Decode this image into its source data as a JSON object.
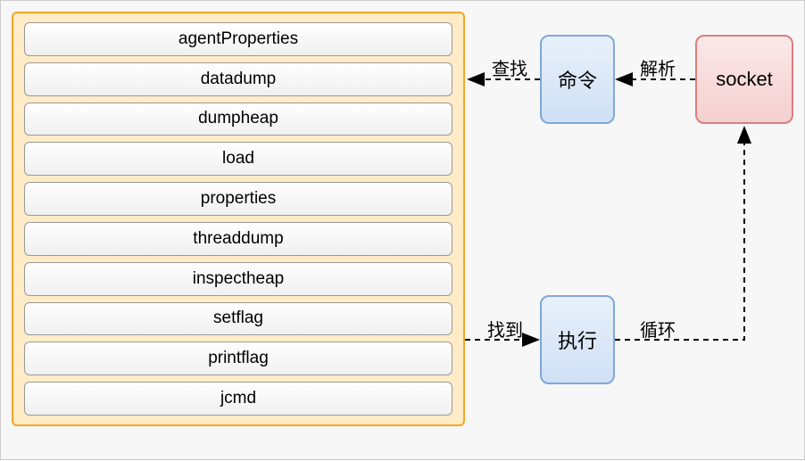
{
  "commands": {
    "items": [
      {
        "label": "agentProperties"
      },
      {
        "label": "datadump"
      },
      {
        "label": "dumpheap"
      },
      {
        "label": "load"
      },
      {
        "label": "properties"
      },
      {
        "label": "threaddump"
      },
      {
        "label": "inspectheap"
      },
      {
        "label": "setflag"
      },
      {
        "label": "printflag"
      },
      {
        "label": "jcmd"
      }
    ]
  },
  "nodes": {
    "command": {
      "label": "命令"
    },
    "socket": {
      "label": "socket"
    },
    "execute": {
      "label": "执行"
    }
  },
  "edges": {
    "lookup": {
      "label": "查找"
    },
    "parse": {
      "label": "解析"
    },
    "found": {
      "label": "找到"
    },
    "loop": {
      "label": "循环"
    }
  }
}
